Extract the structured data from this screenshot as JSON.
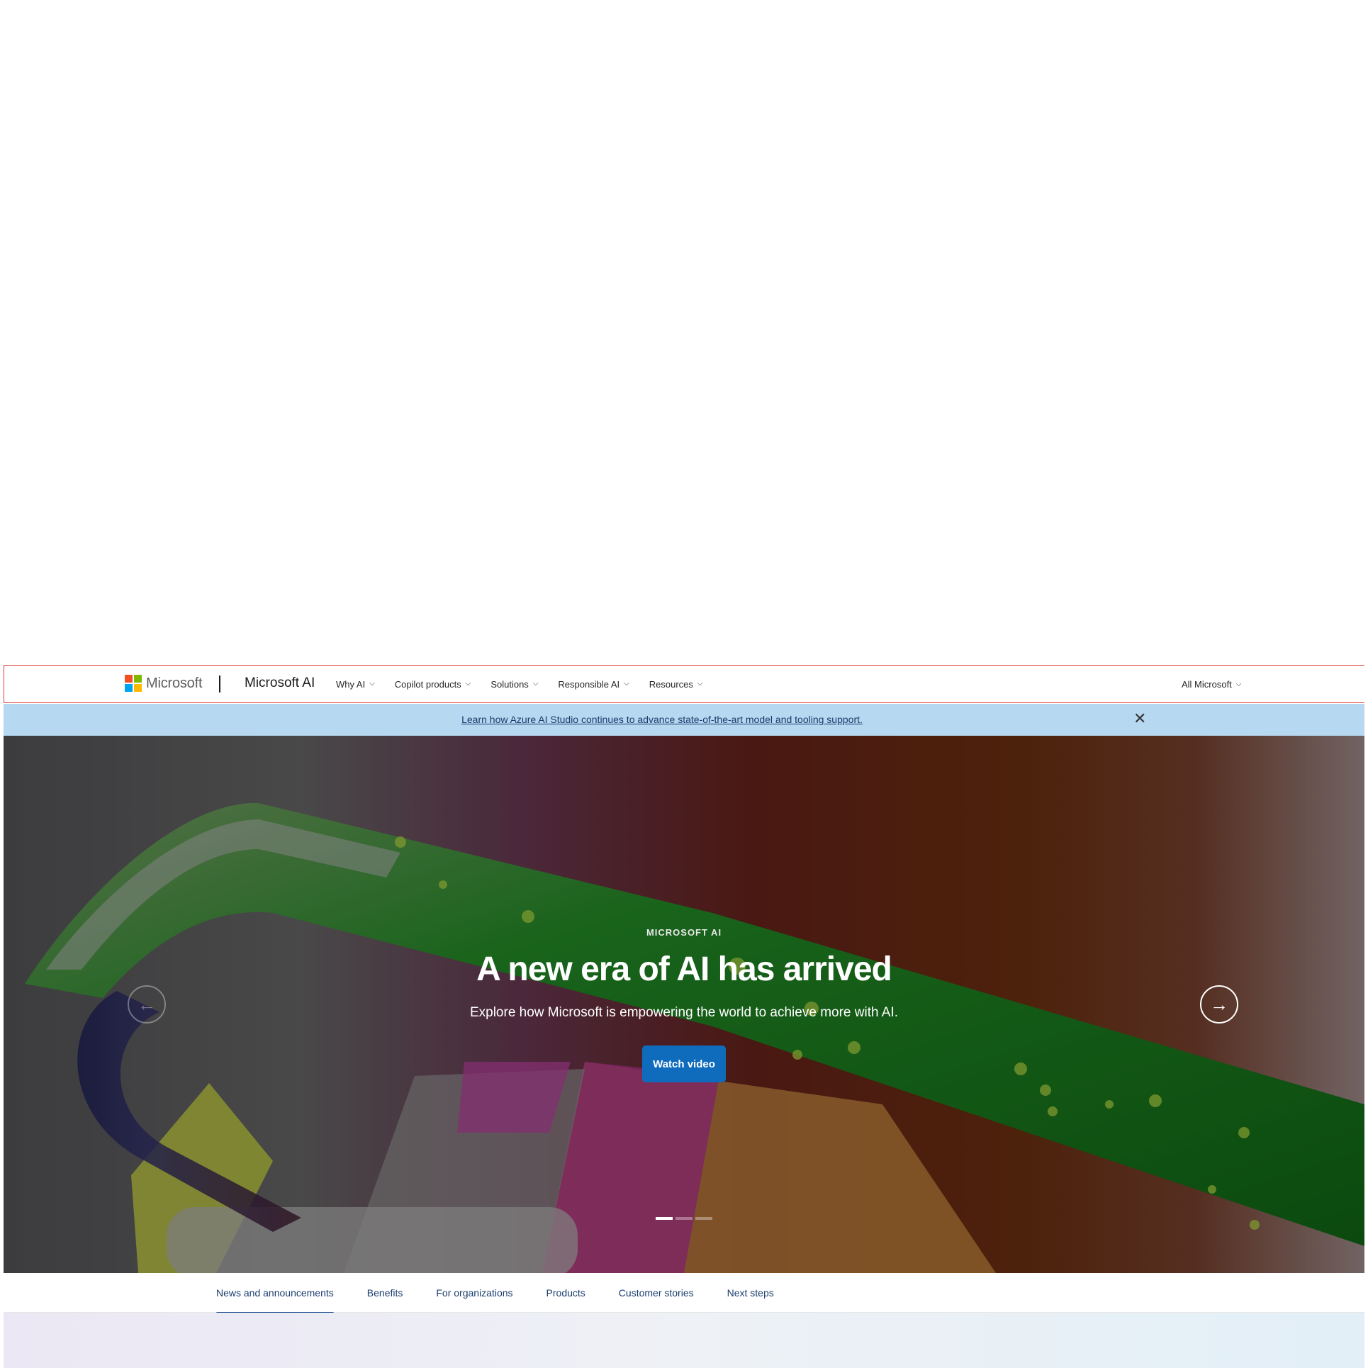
{
  "header": {
    "logo_text": "Microsoft",
    "brand": "Microsoft AI",
    "nav": [
      {
        "label": "Why AI"
      },
      {
        "label": "Copilot products"
      },
      {
        "label": "Solutions"
      },
      {
        "label": "Responsible AI"
      },
      {
        "label": "Resources"
      }
    ],
    "all_microsoft": "All Microsoft",
    "logo_colors": [
      "#f25022",
      "#7fba00",
      "#00a4ef",
      "#ffb900"
    ]
  },
  "banner": {
    "link_text": "Learn how Azure AI Studio continues to advance state-of-the-art model and tooling support.",
    "close_icon": "✕"
  },
  "hero": {
    "eyebrow": "MICROSOFT AI",
    "title": "A new era of AI has arrived",
    "subtitle": "Explore how Microsoft is empowering the world to achieve more with AI.",
    "cta": "Watch video",
    "prev_icon": "←",
    "next_icon": "→",
    "slides_total": 3,
    "active_slide": 1
  },
  "subnav": {
    "items": [
      {
        "label": "News and announcements"
      },
      {
        "label": "Benefits"
      },
      {
        "label": "For organizations"
      },
      {
        "label": "Products"
      },
      {
        "label": "Customer stories"
      },
      {
        "label": "Next steps"
      }
    ]
  },
  "colors": {
    "accent": "#0f6cbd",
    "banner_bg": "#b6d9f1"
  }
}
